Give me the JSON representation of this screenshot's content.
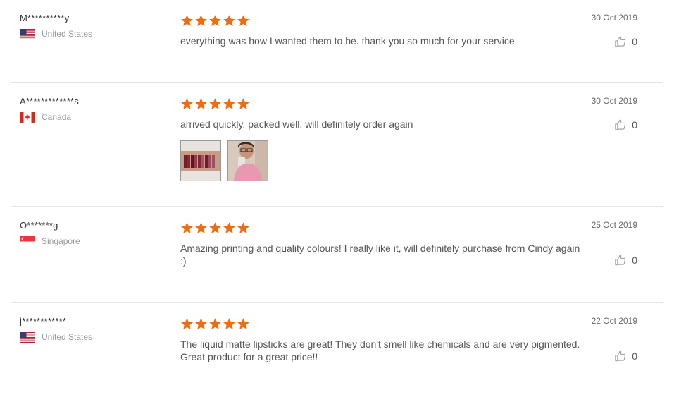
{
  "reviews": [
    {
      "buyer": "M**********y",
      "country": "United States",
      "flag": "us-flag-icon",
      "rating": 5,
      "text": "everything was how I wanted them to be. thank you so much for your service",
      "date": "30 Oct 2019",
      "likes": "0"
    },
    {
      "buyer": "A*************s",
      "country": "Canada",
      "flag": "canada-flag-icon",
      "rating": 5,
      "text": "arrived quickly. packed well. will definitely order again",
      "date": "30 Oct 2019",
      "likes": "0",
      "photos": [
        "photo-lipstick-swatches-arm",
        "photo-mirror-selfie"
      ]
    },
    {
      "buyer": "O*******g",
      "country": "Singapore",
      "flag": "singapore-flag-icon",
      "rating": 5,
      "text": "Amazing printing and quality colours! I really like it, will definitely purchase from Cindy again :)",
      "date": "25 Oct 2019",
      "likes": "0"
    },
    {
      "buyer": "j************",
      "country": "United States",
      "flag": "us-flag-icon",
      "rating": 5,
      "text": "The liquid matte lipsticks are great! They don't smell like chemicals and are very pigmented. Great product for a great price!!",
      "date": "22 Oct 2019",
      "likes": "0"
    }
  ],
  "colors": {
    "star": "#f26c0d",
    "divider": "#e3e3e3",
    "muted_text": "#999999"
  }
}
